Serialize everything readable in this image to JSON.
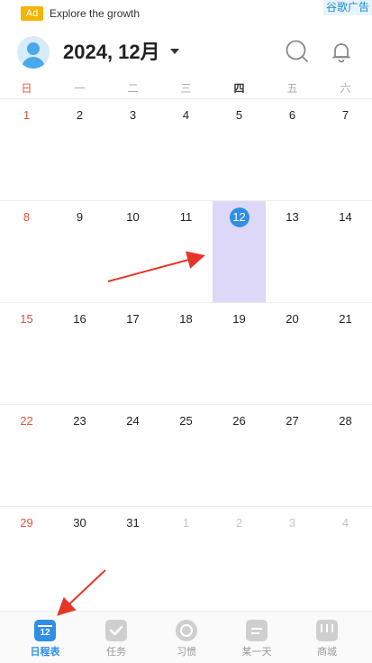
{
  "ad": {
    "badge": "Ad",
    "text": "Explore the growth",
    "tag": "谷歌广告"
  },
  "header": {
    "title": "2024, 12月",
    "search_icon": "search-icon",
    "bell_icon": "bell-icon"
  },
  "weekdays": [
    "日",
    "一",
    "二",
    "三",
    "四",
    "五",
    "六"
  ],
  "weeks": [
    [
      "1",
      "2",
      "3",
      "4",
      "5",
      "6",
      "7"
    ],
    [
      "8",
      "9",
      "10",
      "11",
      "12",
      "13",
      "14"
    ],
    [
      "15",
      "16",
      "17",
      "18",
      "19",
      "20",
      "21"
    ],
    [
      "22",
      "23",
      "24",
      "25",
      "26",
      "27",
      "28"
    ],
    [
      "29",
      "30",
      "31",
      "1",
      "2",
      "3",
      "4"
    ]
  ],
  "today": "12",
  "nav": {
    "items": [
      {
        "label": "日程表",
        "icon": "calendar-icon",
        "badge": "12"
      },
      {
        "label": "任务",
        "icon": "task-check-icon"
      },
      {
        "label": "习惯",
        "icon": "habit-icon"
      },
      {
        "label": "某一天",
        "icon": "clipboard-icon"
      },
      {
        "label": "商城",
        "icon": "store-icon"
      }
    ]
  },
  "colors": {
    "accent": "#2f8fe6",
    "sunday": "#e5533d",
    "today_bg": "#ddd8f8",
    "arrow": "#e8352a"
  }
}
